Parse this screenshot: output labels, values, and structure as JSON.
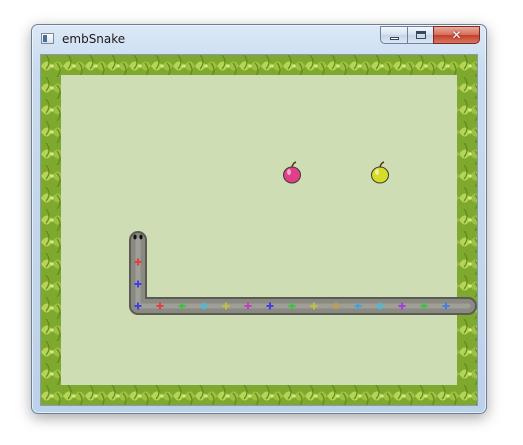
{
  "window": {
    "title": "embSnake",
    "caption_buttons": [
      "minimize",
      "maximize",
      "close"
    ]
  },
  "game": {
    "board_color": "#cfddb4",
    "border_foliage_color": "#8cb43a",
    "grid": {
      "cols": 19,
      "rows": 15
    },
    "apples": [
      {
        "name": "pink-apple",
        "color": "#e0408a",
        "col": 10,
        "row": 4
      },
      {
        "name": "yellow-apple",
        "color": "#d6dc2a",
        "col": 14,
        "row": 4
      }
    ],
    "snake": {
      "body_color": "#8a8a82",
      "head": {
        "col": 3,
        "row": 7,
        "direction": "up"
      },
      "path": [
        [
          3,
          7
        ],
        [
          3,
          8
        ],
        [
          3,
          9
        ],
        [
          3,
          10
        ],
        [
          4,
          10
        ],
        [
          5,
          10
        ],
        [
          6,
          10
        ],
        [
          7,
          10
        ],
        [
          8,
          10
        ],
        [
          9,
          10
        ],
        [
          10,
          10
        ],
        [
          11,
          10
        ],
        [
          12,
          10
        ],
        [
          13,
          10
        ],
        [
          14,
          10
        ],
        [
          15,
          10
        ],
        [
          16,
          10
        ],
        [
          17,
          10
        ],
        [
          18,
          10
        ]
      ],
      "segment_marks": [
        "",
        "#e04040",
        "#4040e0",
        "#4040e0",
        "#e04040",
        "#40c040",
        "#40c0e0",
        "#c0c040",
        "#c040c0",
        "#4040e0",
        "#40c040",
        "#c0c040",
        "#c0a040",
        "#40a0e0",
        "#40c0e0",
        "#a040e0",
        "#40c040",
        "#4080e0",
        ""
      ]
    }
  }
}
